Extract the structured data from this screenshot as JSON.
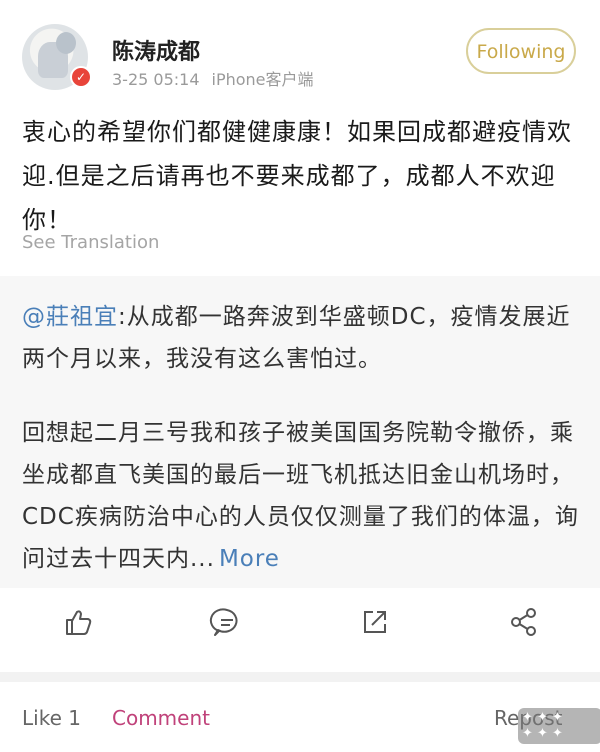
{
  "post": {
    "username": "陈涛成都",
    "timestamp": "3-25 05:14",
    "source": "iPhone客户端",
    "follow_label": "Following",
    "body": "衷心的希望你们都健健康康！如果回成都避疫情欢迎.但是之后请再也不要来成都了，成都人不欢迎你！",
    "see_translation": "See Translation"
  },
  "repost": {
    "mention": "@莊祖宜",
    "text_line1": ":从成都一路奔波到华盛顿DC，疫情发展近两个月以来，我没有这么害怕过。",
    "text_para2": "回想起二月三号我和孩子被美国国务院勒令撤侨，乘坐成都直飞美国的最后一班飞机抵达旧金山机场时，CDC疾病防治中心的人员仅仅测量了我们的体温，询问过去十四天内...",
    "more_label": "More"
  },
  "actions": {
    "like_icon": "thumb-up-icon",
    "comment_icon": "comment-icon",
    "share_icon": "share-external-icon",
    "network_icon": "share-network-icon"
  },
  "tabs": {
    "like": "Like 1",
    "comment": "Comment",
    "repost": "Repost"
  },
  "colors": {
    "accent_gold": "#c9a94a",
    "link_blue": "#4a7fb8",
    "comment_pink": "#c0427a"
  }
}
